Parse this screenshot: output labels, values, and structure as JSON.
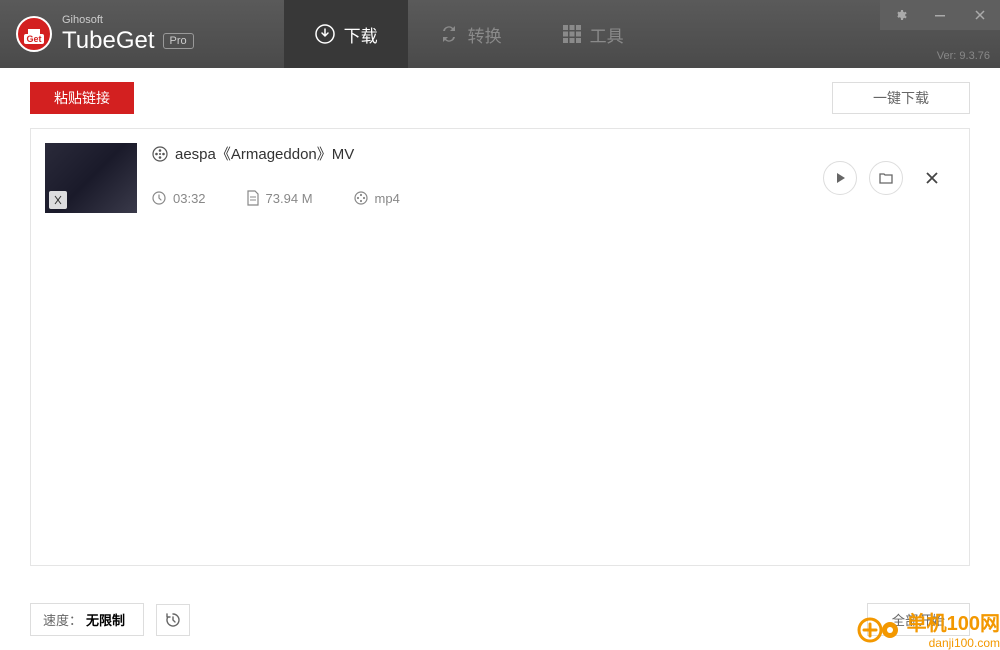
{
  "header": {
    "company": "Gihosoft",
    "app_title": "TubeGet",
    "badge": "Pro",
    "version": "Ver: 9.3.76",
    "logo_text": "Get"
  },
  "tabs": {
    "download": "下载",
    "convert": "转换",
    "tools": "工具"
  },
  "toolbar": {
    "paste_link": "粘贴链接",
    "download_all": "一键下载"
  },
  "item": {
    "title": "aespa《Armageddon》MV",
    "duration": "03:32",
    "size": "73.94 M",
    "format": "mp4"
  },
  "status": {
    "speed_label": "速度：",
    "speed_value": "无限制",
    "start_all": "全部开始"
  },
  "watermark": {
    "text_a": "单机100网",
    "url": "danji100.com"
  }
}
